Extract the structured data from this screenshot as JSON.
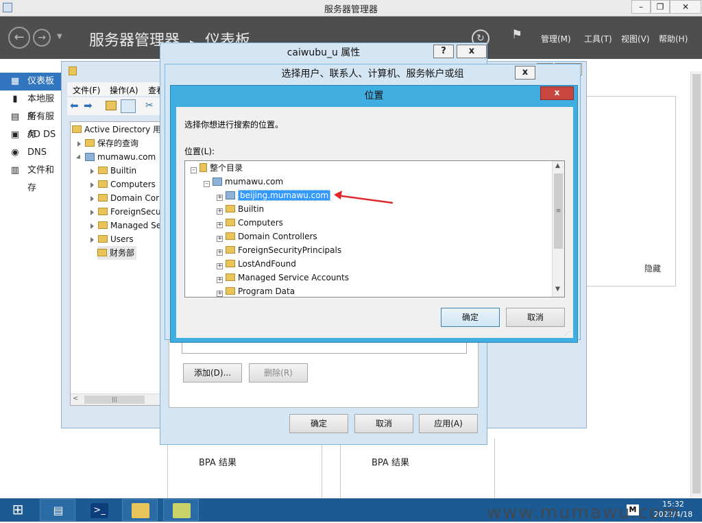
{
  "sm": {
    "title": "服务器管理器",
    "crumb_root": "服务器管理器",
    "crumb_sep": "▸",
    "crumb_page": "仪表板",
    "menu": [
      "管理(M)",
      "工具(T)",
      "视图(V)",
      "帮助(H)"
    ],
    "side": [
      "仪表板",
      "本地服务",
      "所有服务",
      "AD DS",
      "DNS",
      "文件和存"
    ],
    "tile_bpa": "BPA 结果",
    "hide_label": "隐藏"
  },
  "aduc": {
    "menu": [
      "文件(F)",
      "操作(A)",
      "查看"
    ],
    "tree_root": "Active Directory 用",
    "tree_items": [
      "保存的查询",
      "mumawu.com",
      "Builtin",
      "Computers",
      "Domain Cor",
      "ForeignSecu",
      "Managed Se",
      "Users",
      "财务部"
    ]
  },
  "props": {
    "title": "caiwubu_u 属性",
    "help": "?",
    "close": "x",
    "add": "添加(D)...",
    "remove": "删除(R)",
    "ok": "确定",
    "cancel": "取消",
    "apply": "应用(A)"
  },
  "select": {
    "title": "选择用户、联系人、计算机、服务帐户或组",
    "close": "x"
  },
  "location": {
    "title": "位置",
    "close": "x",
    "prompt": "选择你想进行搜索的位置。",
    "list_label": "位置(L):",
    "root": "整个目录",
    "domain": "mumawu.com",
    "items": [
      "beijing.mumawu.com",
      "Builtin",
      "Computers",
      "Domain Controllers",
      "ForeignSecurityPrincipals",
      "LostAndFound",
      "Managed Service Accounts",
      "Program Data"
    ],
    "ok": "确定",
    "cancel": "取消"
  },
  "taskbar": {
    "clock_time": "15:32",
    "clock_date": "2022/4/18"
  },
  "watermark": "www.mumawu.com",
  "colors": {
    "accent": "#3376c0",
    "header": "#4e4e4e",
    "taskbar": "#1c5a93",
    "dialog_frame": "#41aee2",
    "selection": "#3399ff"
  }
}
